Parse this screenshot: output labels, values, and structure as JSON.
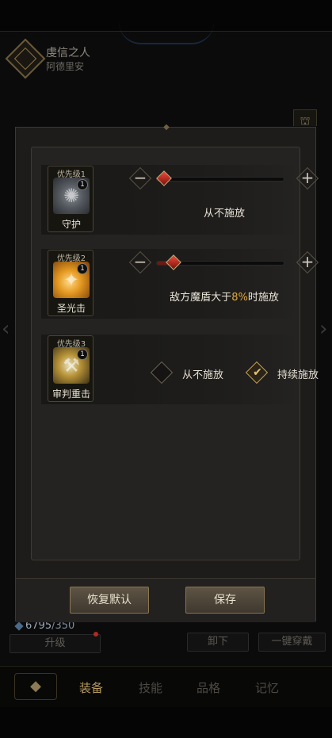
{
  "header": {
    "character_name": "虔信之人",
    "character_subtitle": "阿德里安"
  },
  "side_icon_glyph": "⛫",
  "stats": {
    "current": "6795",
    "max": "/350"
  },
  "actions": {
    "upgrade_label": "升级",
    "unequip_label": "卸下",
    "one_key_label": "一键穿戴"
  },
  "bottom_nav": {
    "home_glyph": "◆",
    "tabs": [
      {
        "label": "装备",
        "active": true
      },
      {
        "label": "技能",
        "active": false
      },
      {
        "label": "品格",
        "active": false
      },
      {
        "label": "记忆",
        "active": false
      }
    ]
  },
  "modal": {
    "skills": [
      {
        "priority": "优先级1",
        "level": "1",
        "name": "守护",
        "control": "slider",
        "slider_value": 0,
        "setting_text": "从不施放"
      },
      {
        "priority": "优先级2",
        "level": "1",
        "name": "圣光击",
        "control": "slider",
        "slider_value": 8,
        "setting_prefix": "敌方魔盾大于",
        "setting_value": "8%",
        "setting_suffix": "时施放"
      },
      {
        "priority": "优先级3",
        "level": "1",
        "name": "审判重击",
        "control": "options",
        "options": [
          {
            "label": "从不施放",
            "selected": false
          },
          {
            "label": "持续施放",
            "selected": true
          }
        ]
      }
    ],
    "reset_label": "恢复默认",
    "save_label": "保存"
  },
  "colors": {
    "accent_gold": "#c9a34f",
    "highlight": "#e0a83a",
    "slider_red": "#f04a3a"
  }
}
